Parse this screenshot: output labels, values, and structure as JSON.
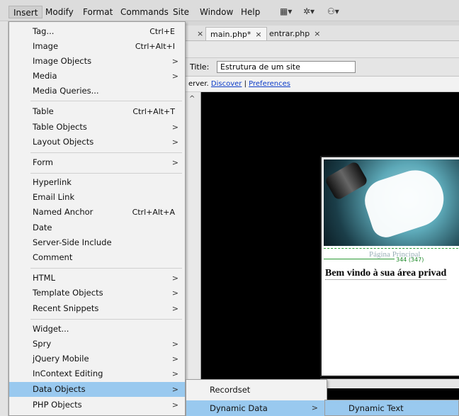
{
  "menubar": {
    "items": [
      "Insert",
      "Modify",
      "Format",
      "Commands",
      "Site",
      "Window",
      "Help"
    ]
  },
  "doc_tabs": [
    {
      "label": ""
    },
    {
      "label": "main.php*"
    },
    {
      "label": "entrar.php"
    }
  ],
  "title_bar": {
    "label": "Title:",
    "value": "Estrutura de um site"
  },
  "info_bar": {
    "prefix": "erver.",
    "discover": "Discover",
    "separator": "|",
    "preferences": "Preferences"
  },
  "design": {
    "caption": "Página Principal",
    "dimension": "344 (347)",
    "welcome": "Bem vindo à sua área privad"
  },
  "insert_menu": {
    "items": [
      {
        "label": "Tag...",
        "shortcut": "Ctrl+E",
        "arrow": ""
      },
      {
        "label": "Image",
        "shortcut": "Ctrl+Alt+I",
        "arrow": ""
      },
      {
        "label": "Image Objects",
        "shortcut": "",
        "arrow": ">"
      },
      {
        "label": "Media",
        "shortcut": "",
        "arrow": ">"
      },
      {
        "label": "Media Queries...",
        "shortcut": "",
        "arrow": ""
      },
      {
        "label": "Table",
        "shortcut": "Ctrl+Alt+T",
        "arrow": ""
      },
      {
        "label": "Table Objects",
        "shortcut": "",
        "arrow": ">"
      },
      {
        "label": "Layout Objects",
        "shortcut": "",
        "arrow": ">"
      },
      {
        "label": "Form",
        "shortcut": "",
        "arrow": ">"
      },
      {
        "label": "Hyperlink",
        "shortcut": "",
        "arrow": ""
      },
      {
        "label": "Email Link",
        "shortcut": "",
        "arrow": ""
      },
      {
        "label": "Named Anchor",
        "shortcut": "Ctrl+Alt+A",
        "arrow": ""
      },
      {
        "label": "Date",
        "shortcut": "",
        "arrow": ""
      },
      {
        "label": "Server-Side Include",
        "shortcut": "",
        "arrow": ""
      },
      {
        "label": "Comment",
        "shortcut": "",
        "arrow": ""
      },
      {
        "label": "HTML",
        "shortcut": "",
        "arrow": ">"
      },
      {
        "label": "Template Objects",
        "shortcut": "",
        "arrow": ">"
      },
      {
        "label": "Recent Snippets",
        "shortcut": "",
        "arrow": ">"
      },
      {
        "label": "Widget...",
        "shortcut": "",
        "arrow": ""
      },
      {
        "label": "Spry",
        "shortcut": "",
        "arrow": ">"
      },
      {
        "label": "jQuery Mobile",
        "shortcut": "",
        "arrow": ">"
      },
      {
        "label": "InContext Editing",
        "shortcut": "",
        "arrow": ">"
      },
      {
        "label": "Data Objects",
        "shortcut": "",
        "arrow": ">"
      },
      {
        "label": "PHP Objects",
        "shortcut": "",
        "arrow": ">"
      }
    ]
  },
  "data_objects_submenu": {
    "recordset": "Recordset",
    "dynamic_data": "Dynamic Data",
    "arrow": ">"
  },
  "dynamic_data_submenu": {
    "dynamic_text": "Dynamic Text"
  },
  "colors": {
    "highlight": "#99c9ef",
    "menu_bg": "#f2f2f2",
    "link": "#0b3bc7"
  }
}
